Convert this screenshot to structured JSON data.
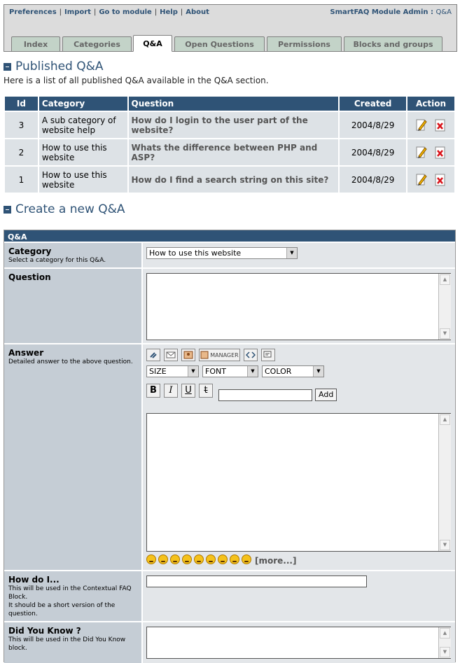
{
  "admin": {
    "links": [
      "Preferences",
      "Import",
      "Go to module",
      "Help",
      "About"
    ],
    "title_bold": "SmartFAQ Module Admin :",
    "title_module": "Q&A"
  },
  "tabs": [
    "Index",
    "Categories",
    "Q&A",
    "Open Questions",
    "Permissions",
    "Blocks and groups"
  ],
  "published": {
    "title": "Published Q&A",
    "intro": "Here is a list of all published Q&A available in the Q&A section.",
    "columns": [
      "Id",
      "Category",
      "Question",
      "Created",
      "Action"
    ],
    "rows": [
      {
        "id": "3",
        "category": "A sub category of website help",
        "question": "How do I login to the user part of the website?",
        "created": "2004/8/29"
      },
      {
        "id": "2",
        "category": "How to use this website",
        "question": "Whats the difference between PHP and ASP?",
        "created": "2004/8/29"
      },
      {
        "id": "1",
        "category": "How to use this website",
        "question": "How do I find a search string on this site?",
        "created": "2004/8/29"
      }
    ]
  },
  "create": {
    "title": "Create a new Q&A",
    "form_header": "Q&A",
    "category": {
      "label": "Category",
      "desc": "Select a category for this Q&A.",
      "value": "How to use this website"
    },
    "question": {
      "label": "Question"
    },
    "answer": {
      "label": "Answer",
      "desc": "Detailed answer to the above question.",
      "manager_label": "MANAGER",
      "size_label": "SIZE",
      "font_label": "FONT",
      "color_label": "COLOR",
      "bold": "B",
      "italic": "I",
      "underline": "U",
      "strike": "t",
      "add_label": "Add",
      "more_label": "[more...]"
    },
    "howdoi": {
      "label": "How do I...",
      "desc1": "This will be used in the Contextual FAQ Block.",
      "desc2": "It should be a short version of the question."
    },
    "dyk": {
      "label": "Did You Know ?",
      "desc": "This will be used in the Did You Know block."
    }
  },
  "colors": {
    "header_blue": "#2f5376",
    "tab_green": "#c3d3c8",
    "label_bg": "#c5cdd5",
    "row_bg": "#dde2e6"
  }
}
